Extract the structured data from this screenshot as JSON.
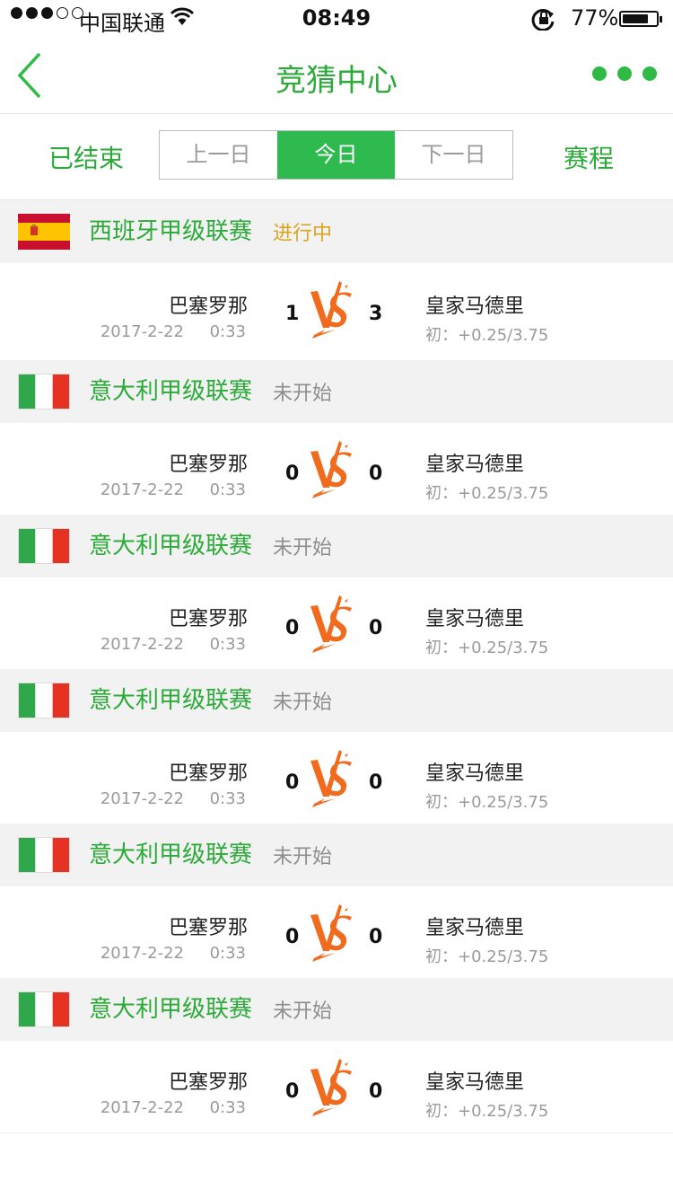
{
  "status_bar": {
    "carrier": "中国联通",
    "time": "08:49",
    "battery_percent": "77%",
    "battery_level": 0.77
  },
  "nav": {
    "title": "竞猜中心"
  },
  "toolbar": {
    "ended_label": "已结束",
    "schedule_label": "赛程",
    "tabs": [
      "上一日",
      "今日",
      "下一日"
    ],
    "active_tab": "今日"
  },
  "colors": {
    "brand_green": "#2caa3a",
    "live_status": "#d9a520",
    "pending_status": "#8e8e8e",
    "vs_orange": "#f06b1d"
  },
  "sections": [
    {
      "league": "西班牙甲级联赛",
      "status": "进行中",
      "status_type": "live",
      "flag": "spain-flag",
      "home": "巴塞罗那",
      "away": "皇家马德里",
      "home_score": "1",
      "away_score": "3",
      "date": "2017-2-22",
      "time": "0:33",
      "odds": "初：+0.25/3.75"
    },
    {
      "league": "意大利甲级联赛",
      "status": "未开始",
      "status_type": "pending",
      "flag": "italy-flag",
      "home": "巴塞罗那",
      "away": "皇家马德里",
      "home_score": "0",
      "away_score": "0",
      "date": "2017-2-22",
      "time": "0:33",
      "odds": "初：+0.25/3.75"
    },
    {
      "league": "意大利甲级联赛",
      "status": "未开始",
      "status_type": "pending",
      "flag": "italy-flag",
      "home": "巴塞罗那",
      "away": "皇家马德里",
      "home_score": "0",
      "away_score": "0",
      "date": "2017-2-22",
      "time": "0:33",
      "odds": "初：+0.25/3.75"
    },
    {
      "league": "意大利甲级联赛",
      "status": "未开始",
      "status_type": "pending",
      "flag": "italy-flag",
      "home": "巴塞罗那",
      "away": "皇家马德里",
      "home_score": "0",
      "away_score": "0",
      "date": "2017-2-22",
      "time": "0:33",
      "odds": "初：+0.25/3.75"
    },
    {
      "league": "意大利甲级联赛",
      "status": "未开始",
      "status_type": "pending",
      "flag": "italy-flag",
      "home": "巴塞罗那",
      "away": "皇家马德里",
      "home_score": "0",
      "away_score": "0",
      "date": "2017-2-22",
      "time": "0:33",
      "odds": "初：+0.25/3.75"
    },
    {
      "league": "意大利甲级联赛",
      "status": "未开始",
      "status_type": "pending",
      "flag": "italy-flag",
      "home": "巴塞罗那",
      "away": "皇家马德里",
      "home_score": "0",
      "away_score": "0",
      "date": "2017-2-22",
      "time": "0:33",
      "odds": "初：+0.25/3.75"
    }
  ]
}
